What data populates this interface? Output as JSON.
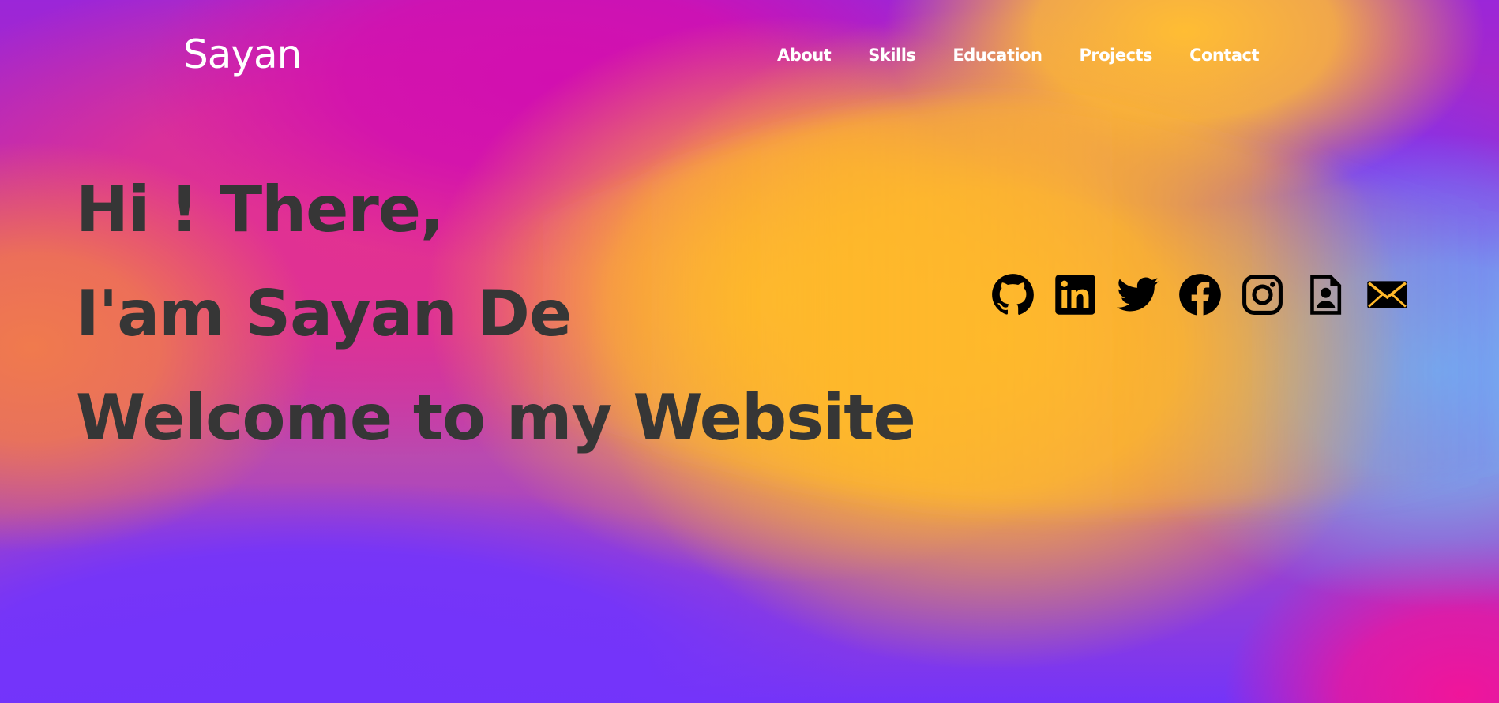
{
  "header": {
    "logo": "Sayan",
    "nav": [
      "About",
      "Skills",
      "Education",
      "Projects",
      "Contact"
    ]
  },
  "hero": {
    "lines": [
      "Hi ! There,",
      "I'am Sayan De",
      "Welcome to my Website"
    ]
  },
  "social": [
    {
      "icon": "github-icon"
    },
    {
      "icon": "linkedin-icon"
    },
    {
      "icon": "twitter-icon"
    },
    {
      "icon": "facebook-icon"
    },
    {
      "icon": "instagram-icon"
    },
    {
      "icon": "resume-icon"
    },
    {
      "icon": "email-icon"
    }
  ],
  "colors": {
    "heading": "#363636",
    "nav_text": "#ffffff",
    "icon": "#000000",
    "gradient_yellow": "#ffb92a",
    "gradient_magenta": "#d20fb0",
    "gradient_purple": "#7334fb",
    "gradient_blue": "#6fb4f5",
    "gradient_pink": "#f0159a"
  }
}
